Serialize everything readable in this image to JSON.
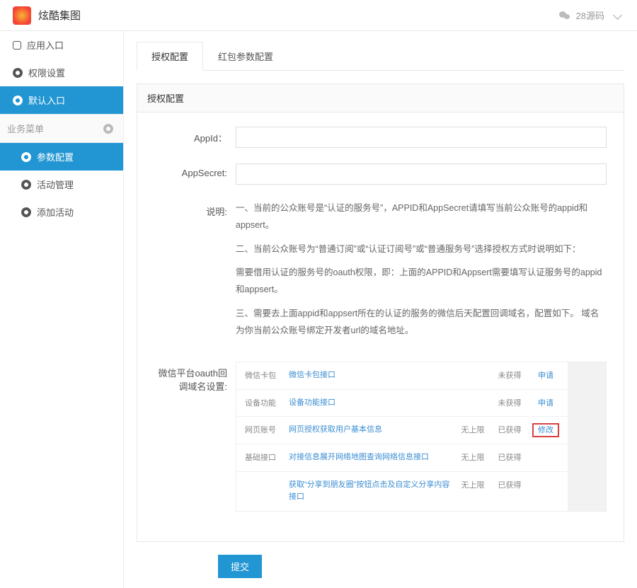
{
  "header": {
    "title": "炫酷集图",
    "source_label": "28源码"
  },
  "sidebar": {
    "items": [
      {
        "label": "应用入口",
        "icon": "entry-icon",
        "active": false
      },
      {
        "label": "权限设置",
        "icon": "gear-icon",
        "active": false
      },
      {
        "label": "默认入口",
        "icon": "gear-icon",
        "active": true
      }
    ],
    "section_label": "业务菜单",
    "sub_items": [
      {
        "label": "参数配置",
        "icon": "gear-icon",
        "active": true
      },
      {
        "label": "活动管理",
        "icon": "gear-icon",
        "active": false
      },
      {
        "label": "添加活动",
        "icon": "gear-icon",
        "active": false
      }
    ]
  },
  "tabs": [
    {
      "label": "授权配置",
      "active": true
    },
    {
      "label": "红包参数配置",
      "active": false
    }
  ],
  "panel": {
    "title": "授权配置",
    "fields": {
      "appid_label": "AppId：",
      "appid_value": "",
      "appsecret_label": "AppSecret:",
      "appsecret_value": "",
      "desc_label": "说明:",
      "desc_lines": [
        "一、当前的公众账号是“认证的服务号”，APPID和AppSecret请填写当前公众账号的appid和appsert。",
        "二、当前公众账号为“普通订阅”或“认证订阅号”或“普通服务号”选择授权方式时说明如下：",
        "需要借用认证的服务号的oauth权限，即：上面的APPID和Appsert需要填写认证服务号的appid和appsert。",
        "三、需要去上面appid和appsert所在的认证的服务的微信后天配置回调域名，配置如下。 域名为你当前公众账号绑定开发者url的域名地址。"
      ],
      "callback_label": "微信平台oauth回调域名设置:",
      "callback_table": [
        {
          "c1": "微信卡包",
          "c2": "微信卡包接口",
          "c3": "",
          "c4": "未获得",
          "c5": "申请"
        },
        {
          "c1": "设备功能",
          "c2": "设备功能接口",
          "c3": "",
          "c4": "未获得",
          "c5": "申请"
        },
        {
          "c1": "网页账号",
          "c2": "网页授权获取用户基本信息",
          "c3": "无上限",
          "c4": "已获得",
          "c5": "修改",
          "highlight": true
        },
        {
          "c1": "基础接口",
          "c2": "对接信息展开网络地图查询网络信息接口",
          "c3": "无上限",
          "c4": "已获得",
          "c5": ""
        },
        {
          "c1": "",
          "c2": "获取“分享到朋友圈”按钮点击及自定义分享内容接口",
          "c3": "无上限",
          "c4": "已获得",
          "c5": ""
        }
      ]
    },
    "submit_label": "提交"
  }
}
